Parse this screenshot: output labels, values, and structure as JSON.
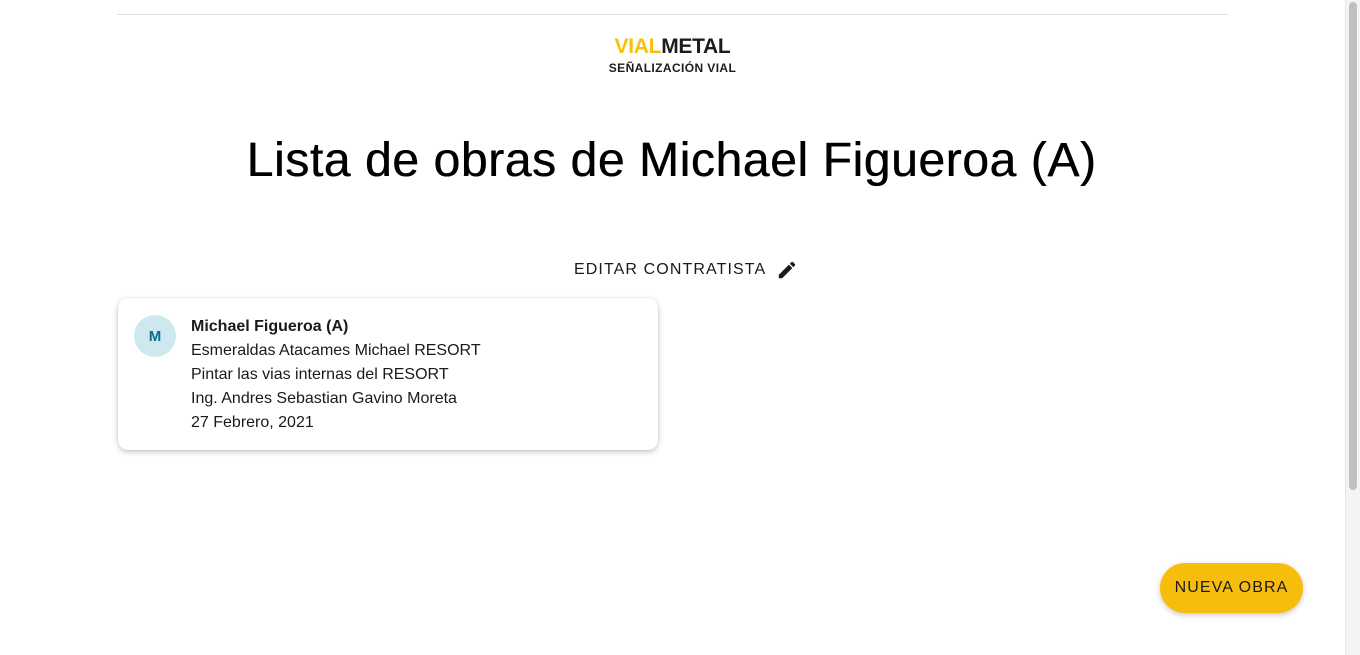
{
  "header": {
    "logo_part1": "VIAL",
    "logo_part2": "METAL",
    "logo_subtitle": "SEÑALIZACIÓN VIAL",
    "accent_color": "#f5c10a"
  },
  "main": {
    "title": "Lista de obras de Michael Figueroa (A)",
    "edit_button_label": "EDITAR CONTRATISTA",
    "edit_icon": "pencil-icon"
  },
  "works": [
    {
      "avatar_initial": "M",
      "contractor": "Michael Figueroa (A)",
      "location": "Esmeraldas Atacames Michael RESORT",
      "description": "Pintar las vias internas del RESORT",
      "engineer": "Ing. Andres Sebastian Gavino Moreta",
      "date": "27 Febrero, 2021"
    }
  ],
  "fab": {
    "label": "NUEVA OBRA",
    "color": "#f7bd0d"
  }
}
